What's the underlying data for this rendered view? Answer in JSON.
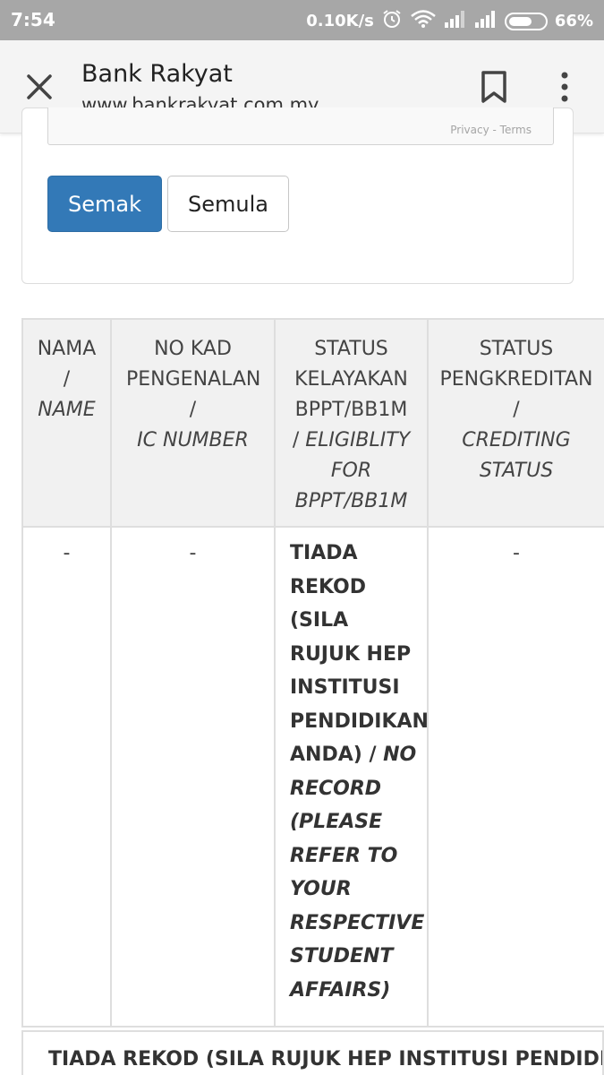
{
  "status_bar": {
    "time": "7:54",
    "network_speed": "0.10K/s",
    "battery_percent": "66%",
    "battery_level": 0.66,
    "icons": [
      "alarm-icon",
      "wifi-icon",
      "signal-icon",
      "signal-icon",
      "battery-icon"
    ]
  },
  "toolbar": {
    "title": "Bank Rakyat",
    "url": "www.bankrakyat.com.my",
    "icons": {
      "close": "close-icon",
      "bookmark": "bookmark-icon",
      "menu": "overflow-menu-icon"
    }
  },
  "form": {
    "captcha_links": "Privacy - Terms",
    "check_button": "Semak",
    "reset_button": "Semula"
  },
  "results_table": {
    "headers": [
      {
        "ms": "NAMA",
        "sep": "/",
        "en": "NAME"
      },
      {
        "ms": "NO KAD PENGENALAN",
        "sep": "/",
        "en": "IC NUMBER"
      },
      {
        "ms": "STATUS KELAYAKAN BPPT/BB1M",
        "sep": "/",
        "en": "ELIGIBLITY FOR BPPT/BB1M"
      },
      {
        "ms": "STATUS PENGKREDITAN",
        "sep": "/",
        "en": "CREDITING STATUS"
      }
    ],
    "row": {
      "name": "-",
      "ic_number": "-",
      "eligibility_ms": "TIADA REKOD (SILA RUJUK HEP INSTITUSI PENDIDIKAN ANDA) / ",
      "eligibility_en": "NO RECORD (PLEASE REFER TO YOUR RESPECTIVE STUDENT AFFAIRS)",
      "crediting_status": "-"
    }
  },
  "footer_message": "TIADA REKOD (SILA RUJUK HEP INSTITUSI PENDIDIKAN"
}
